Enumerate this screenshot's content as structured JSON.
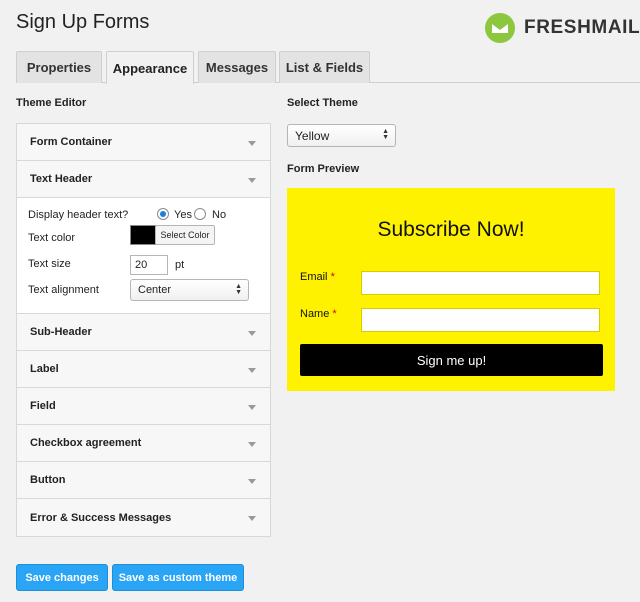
{
  "header": {
    "title": "Sign Up Forms",
    "brand_name": "FRESHMAIL",
    "brand_color": "#8dc63f"
  },
  "tabs": [
    {
      "label": "Properties",
      "active": false
    },
    {
      "label": "Appearance",
      "active": true
    },
    {
      "label": "Messages",
      "active": false
    },
    {
      "label": "List & Fields",
      "active": false
    }
  ],
  "theme_editor": {
    "heading": "Theme Editor",
    "sections": [
      {
        "label": "Form Container",
        "expanded": false
      },
      {
        "label": "Text Header",
        "expanded": true
      },
      {
        "label": "Sub-Header",
        "expanded": false
      },
      {
        "label": "Label",
        "expanded": false
      },
      {
        "label": "Field",
        "expanded": false
      },
      {
        "label": "Checkbox agreement",
        "expanded": false
      },
      {
        "label": "Button",
        "expanded": false
      },
      {
        "label": "Error & Success Messages",
        "expanded": false
      }
    ],
    "text_header": {
      "display_label": "Display header text?",
      "yes_label": "Yes",
      "no_label": "No",
      "display_value": "Yes",
      "color_label": "Text color",
      "color_value": "#000000",
      "color_button": "Select Color",
      "size_label": "Text size",
      "size_value": "20",
      "size_unit": "pt",
      "alignment_label": "Text alignment",
      "alignment_value": "Center"
    }
  },
  "select_theme": {
    "heading": "Select Theme",
    "value": "Yellow"
  },
  "preview": {
    "heading": "Form Preview",
    "background": "#fff200",
    "title": "Subscribe Now!",
    "email_label": "Email",
    "name_label": "Name",
    "required_mark": "*",
    "submit_label": "Sign me up!"
  },
  "actions": {
    "save_label": "Save changes",
    "save_custom_label": "Save as custom theme",
    "accent": "#2aa4f4"
  }
}
